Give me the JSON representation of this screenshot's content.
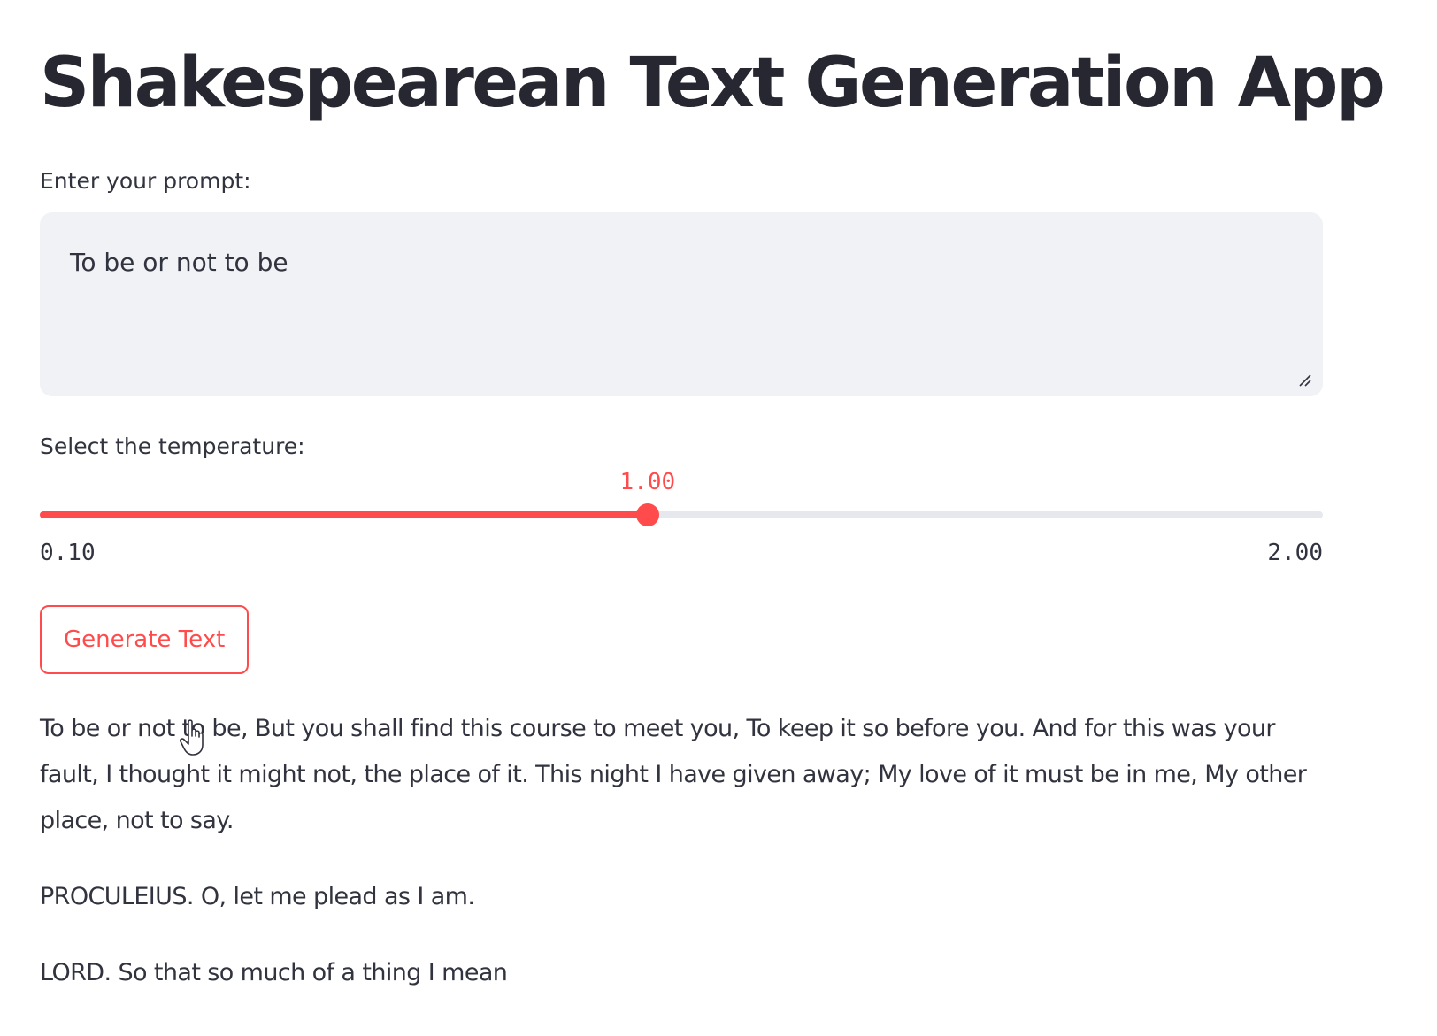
{
  "app": {
    "title": "Shakespearean Text Generation App"
  },
  "prompt": {
    "label": "Enter your prompt:",
    "value": "To be or not to be"
  },
  "temperature": {
    "label": "Select the temperature:",
    "value_text": "1.00",
    "value": 1.0,
    "min_text": "0.10",
    "max_text": "2.00",
    "min": 0.1,
    "max": 2.0
  },
  "generate_button": {
    "label": "Generate Text"
  },
  "output": {
    "paragraphs": [
      "To be or not to be, But you shall find this course to meet you, To keep it so before you. And for this was your fault, I thought it might not, the place of it. This night I have given away; My love of it must be in me, My other place, not to say.",
      "PROCULEIUS. O, let me plead as I am.",
      "LORD. So that so much of a thing I mean"
    ]
  },
  "colors": {
    "accent": "#ff4b4b",
    "input_bg": "#f0f2f6",
    "text": "#31333f",
    "title": "#262730"
  },
  "icons": {
    "resize": "resize-handle-icon",
    "cursor": "hand-pointer-cursor-icon"
  }
}
